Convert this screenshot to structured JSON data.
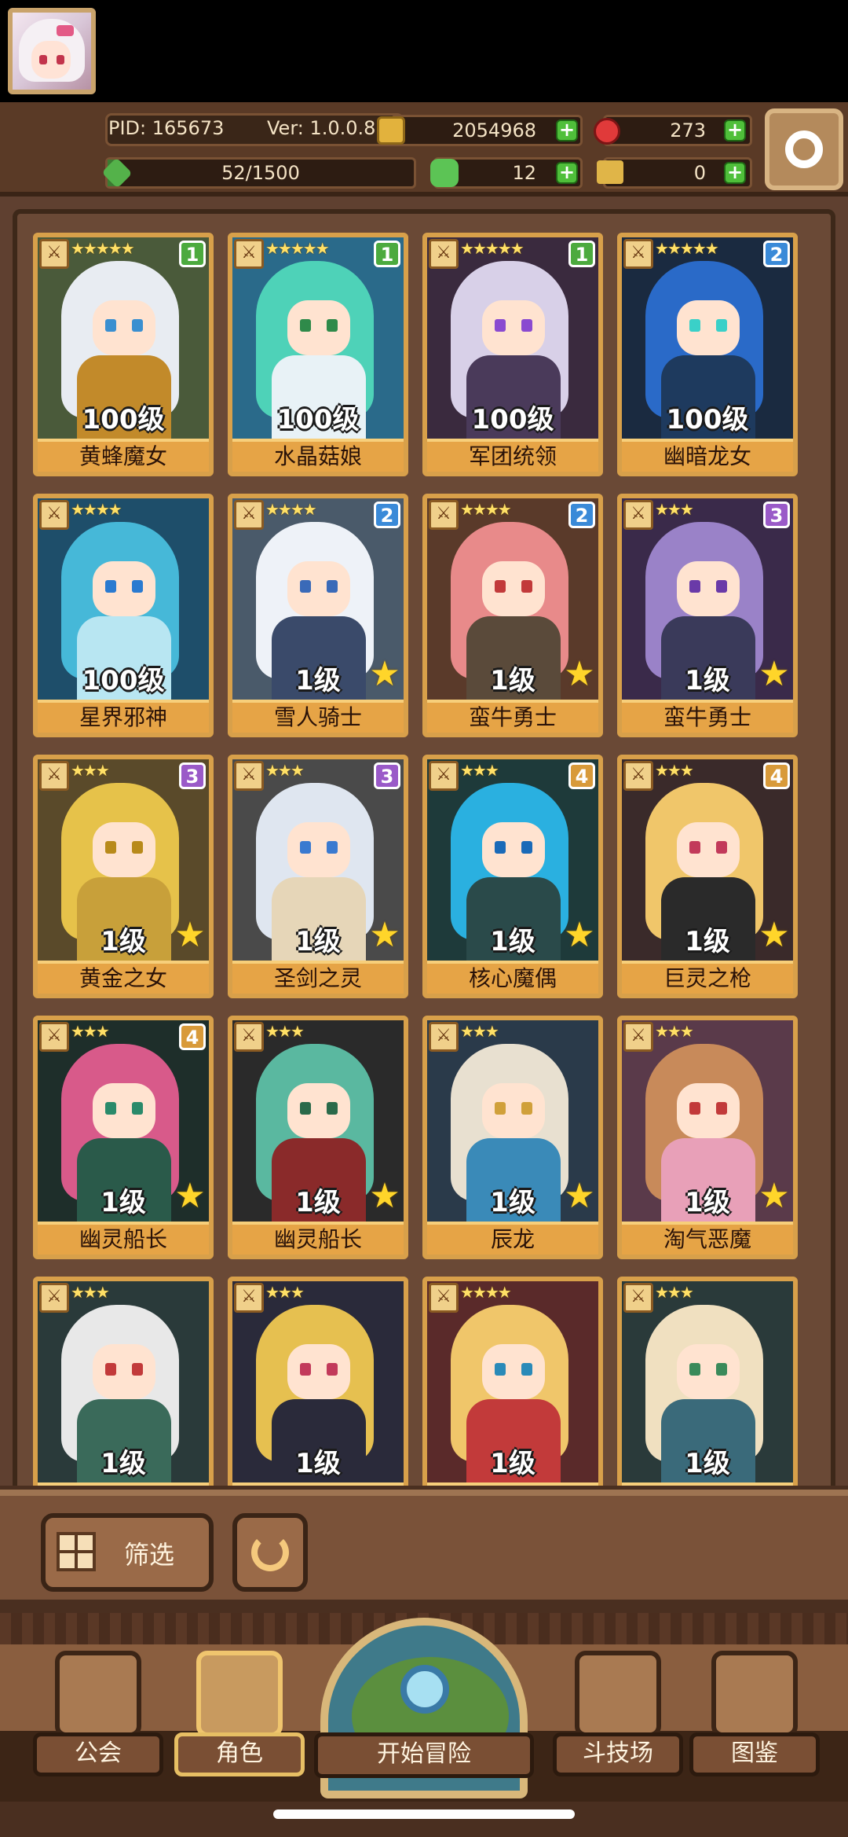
{
  "header": {
    "pid": "PID: 165673",
    "version": "Ver: 1.0.0.8",
    "coins": "2054968",
    "gems": "273",
    "exp": "52/1500",
    "exp_fraction": 0.035,
    "clover": "12",
    "keys": "0"
  },
  "filter": {
    "label": "筛选"
  },
  "nav": {
    "guild": "公会",
    "characters": "角色",
    "adventure": "开始冒险",
    "arena": "斗技场",
    "codex": "图鉴"
  },
  "heroes": [
    {
      "name": "黄蜂魔女",
      "level": "100级",
      "rank": "1",
      "stars": "★★★★★",
      "hair": "#e8ecf2",
      "eye": "#3a8fd0",
      "outfit": "#c28a2a",
      "bg": "#4a5a3a",
      "rank_color": "#4caa3e",
      "upgrade": false
    },
    {
      "name": "水晶菇娘",
      "level": "100级",
      "rank": "1",
      "stars": "★★★★★",
      "hair": "#4ed2b8",
      "eye": "#2f8a4a",
      "outfit": "#e8f2f6",
      "bg": "#2a6a8a",
      "rank_color": "#4caa3e",
      "upgrade": false
    },
    {
      "name": "军团统领",
      "level": "100级",
      "rank": "1",
      "stars": "★★★★★",
      "hair": "#d8d0e8",
      "eye": "#8a4ad0",
      "outfit": "#4a3a5a",
      "bg": "#3a2a3e",
      "rank_color": "#4caa3e",
      "upgrade": false
    },
    {
      "name": "幽暗龙女",
      "level": "100级",
      "rank": "2",
      "stars": "★★★★★",
      "hair": "#2a6ac8",
      "eye": "#3ad0c8",
      "outfit": "#1e3a5e",
      "bg": "#1a2a40",
      "rank_color": "#3a8ad8",
      "upgrade": false
    },
    {
      "name": "星界邪神",
      "level": "100级",
      "rank": "",
      "stars": "★★★★",
      "hair": "#46b8d8",
      "eye": "#2a7ad0",
      "outfit": "#b8e6f2",
      "bg": "#1e4e6a",
      "rank_color": "#3a8ad8",
      "upgrade": false
    },
    {
      "name": "雪人骑士",
      "level": "1级",
      "rank": "2",
      "stars": "★★★★",
      "hair": "#eef2f8",
      "eye": "#3a6ab8",
      "outfit": "#3a4a6a",
      "bg": "#4a5a6a",
      "rank_color": "#3a8ad8",
      "upgrade": true
    },
    {
      "name": "蛮牛勇士",
      "level": "1级",
      "rank": "2",
      "stars": "★★★★",
      "hair": "#e88a8a",
      "eye": "#c23a3a",
      "outfit": "#5a4a3a",
      "bg": "#5a3a2a",
      "rank_color": "#3a8ad8",
      "upgrade": true
    },
    {
      "name": "蛮牛勇士",
      "level": "1级",
      "rank": "3",
      "stars": "★★★",
      "hair": "#9a82c8",
      "eye": "#6a3aa8",
      "outfit": "#3a3a5a",
      "bg": "#3a2a4a",
      "rank_color": "#9a5ac8",
      "upgrade": true
    },
    {
      "name": "黄金之女",
      "level": "1级",
      "rank": "3",
      "stars": "★★★",
      "hair": "#e6c24a",
      "eye": "#b88a1a",
      "outfit": "#c8a03a",
      "bg": "#5a4a2a",
      "rank_color": "#9a5ac8",
      "upgrade": true
    },
    {
      "name": "圣剑之灵",
      "level": "1级",
      "rank": "3",
      "stars": "★★★",
      "hair": "#dfe6f0",
      "eye": "#3a7ad0",
      "outfit": "#e6d6b8",
      "bg": "#4a4a4a",
      "rank_color": "#9a5ac8",
      "upgrade": true
    },
    {
      "name": "核心魔偶",
      "level": "1级",
      "rank": "4",
      "stars": "★★★",
      "hair": "#2ab0e0",
      "eye": "#1a6ab8",
      "outfit": "#2a4a4a",
      "bg": "#1e3a3a",
      "rank_color": "#d89a3a",
      "upgrade": true
    },
    {
      "name": "巨灵之枪",
      "level": "1级",
      "rank": "4",
      "stars": "★★★",
      "hair": "#f0c66a",
      "eye": "#c23a5a",
      "outfit": "#2a2a2a",
      "bg": "#3a2a2a",
      "rank_color": "#d89a3a",
      "upgrade": true
    },
    {
      "name": "幽灵船长",
      "level": "1级",
      "rank": "4",
      "stars": "★★★",
      "hair": "#d85a8a",
      "eye": "#2a8a6a",
      "outfit": "#2a5a4a",
      "bg": "#1e2e2a",
      "rank_color": "#d89a3a",
      "upgrade": true
    },
    {
      "name": "幽灵船长",
      "level": "1级",
      "rank": "",
      "stars": "★★★",
      "hair": "#5ab8a0",
      "eye": "#2a6a4a",
      "outfit": "#8a2a2a",
      "bg": "#2a2a2a",
      "rank_color": "#d89a3a",
      "upgrade": true
    },
    {
      "name": "辰龙",
      "level": "1级",
      "rank": "",
      "stars": "★★★",
      "hair": "#e8e0d0",
      "eye": "#d0a03a",
      "outfit": "#3a8ab8",
      "bg": "#2a3a4a",
      "rank_color": "#d89a3a",
      "upgrade": true
    },
    {
      "name": "淘气恶魔",
      "level": "1级",
      "rank": "",
      "stars": "★★★",
      "hair": "#c88a5a",
      "eye": "#c23a3a",
      "outfit": "#e8a0b8",
      "bg": "#5a3a4a",
      "rank_color": "#d89a3a",
      "upgrade": true
    },
    {
      "name": "",
      "level": "1级",
      "rank": "",
      "stars": "★★★",
      "hair": "#e8e8e8",
      "eye": "#c23a3a",
      "outfit": "#3a6a5a",
      "bg": "#2a3a3a",
      "rank_color": "#d89a3a",
      "upgrade": false
    },
    {
      "name": "",
      "level": "1级",
      "rank": "",
      "stars": "★★★",
      "hair": "#e6c050",
      "eye": "#c23a5a",
      "outfit": "#2a2a3a",
      "bg": "#2a2a3a",
      "rank_color": "#d89a3a",
      "upgrade": false
    },
    {
      "name": "",
      "level": "1级",
      "rank": "",
      "stars": "★★★★",
      "hair": "#f0c66a",
      "eye": "#2a8ab8",
      "outfit": "#c23a3a",
      "bg": "#5a2a2a",
      "rank_color": "#d89a3a",
      "upgrade": false
    },
    {
      "name": "",
      "level": "1级",
      "rank": "",
      "stars": "★★★",
      "hair": "#f0e0c0",
      "eye": "#3a8a5a",
      "outfit": "#3a6a7a",
      "bg": "#2a3a3a",
      "rank_color": "#d89a3a",
      "upgrade": false
    }
  ]
}
